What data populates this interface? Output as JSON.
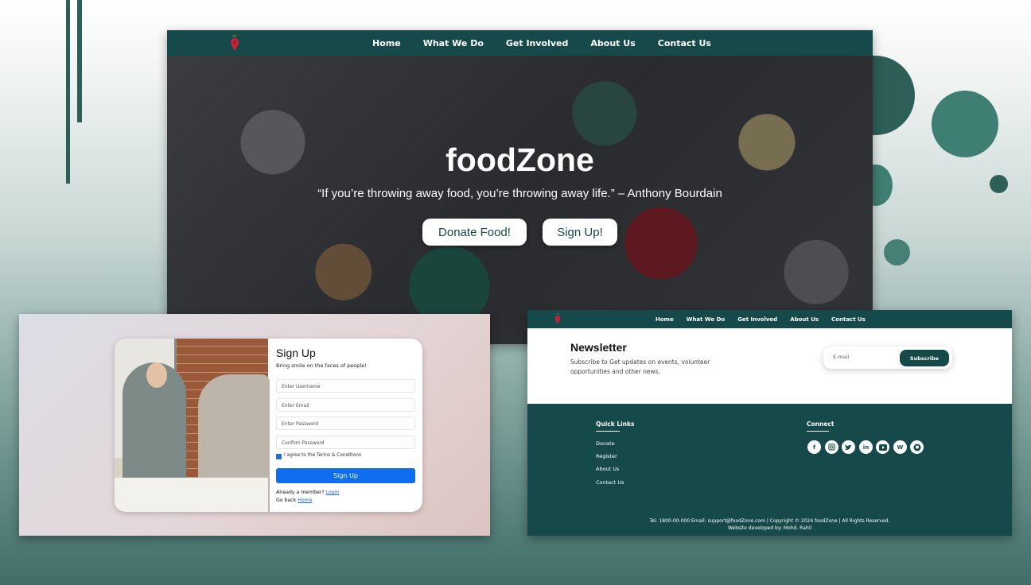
{
  "hero": {
    "nav": [
      "Home",
      "What We Do",
      "Get Involved",
      "About Us",
      "Contact Us"
    ],
    "title": "foodZone",
    "quote": "“If you’re throwing away food, you’re throwing away life.” – Anthony Bourdain",
    "donate_label": "Donate Food!",
    "signup_label": "Sign Up!"
  },
  "signup": {
    "title": "Sign Up",
    "subtitle": "Bring smile on the faces of people!",
    "username_placeholder": "Enter Username",
    "email_placeholder": "Enter Email",
    "password_placeholder": "Enter Password",
    "confirm_placeholder": "Confirm Password",
    "terms_label": "I agree to the Terms & Conditions",
    "button_label": "Sign Up",
    "member_text": "Already a member?",
    "login_link": "Login",
    "goback_text": "Go back",
    "home_link": "Home"
  },
  "footer_page": {
    "nav": [
      "Home",
      "What We Do",
      "Get Involved",
      "About Us",
      "Contact Us"
    ],
    "newsletter_title": "Newsletter",
    "newsletter_desc": "Subscribe to Get updates on events, volunteer opportunities and other news.",
    "email_placeholder": "E-mail",
    "subscribe_label": "Subscribe",
    "quick_links_title": "Quick Links",
    "quick_links": [
      "Donate",
      "Register",
      "About Us",
      "Contact Us"
    ],
    "connect_title": "Connect",
    "social": [
      "facebook-icon",
      "instagram-icon",
      "twitter-icon",
      "linkedin-icon",
      "youtube-icon",
      "wordpress-icon",
      "github-icon"
    ],
    "contact_line": "Tel: 1800-00-000 Email: support@foodZone.com | Copyright © 2024 foodZone | All Rights Reserved.",
    "credit_line": "Website developed by: Mohd. Rahil"
  },
  "colors": {
    "brand": "#15494a",
    "accent_blue": "#0f6ef0",
    "logo_red": "#c0243a"
  }
}
